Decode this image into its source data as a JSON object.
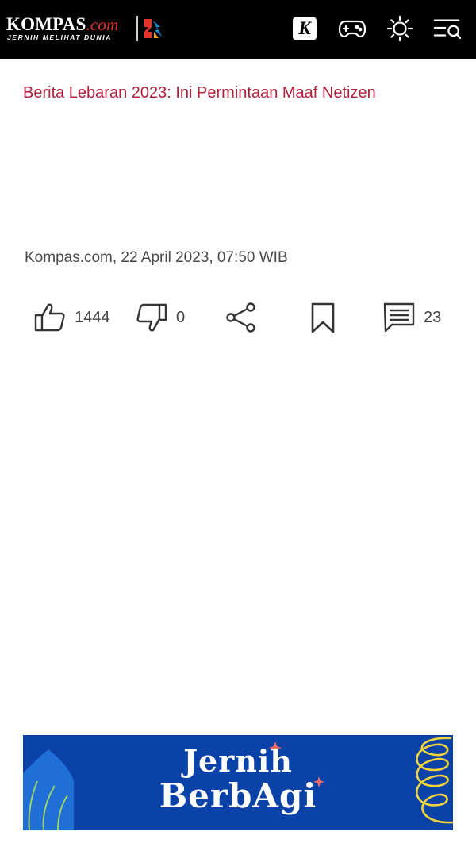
{
  "header": {
    "logo_word": "KOMPAS",
    "logo_dotcom": ".com",
    "logo_tagline": "JERNIH MELIHAT DUNIA",
    "kompas_k": "K",
    "icons": [
      "kompas-k-icon",
      "gamepad-icon",
      "sun-icon",
      "menu-search-icon"
    ]
  },
  "article": {
    "headline": "Berita Lebaran 2023: Ini Permintaan Maaf Netizen",
    "meta": "Kompas.com, 22 April 2023, 07:50 WIB"
  },
  "actions": {
    "like_count": "1444",
    "dislike_count": "0",
    "comment_count": "23",
    "icons": [
      "thumbs-up-icon",
      "thumbs-down-icon",
      "share-icon",
      "bookmark-icon",
      "comment-icon"
    ]
  },
  "banner": {
    "line1": "Jernih",
    "line2": "BerbAgi",
    "background": "#0a42a8"
  },
  "colors": {
    "topbar": "#000000",
    "headline": "#b3203b",
    "meta": "#4a4a4a",
    "icon": "#333333"
  }
}
